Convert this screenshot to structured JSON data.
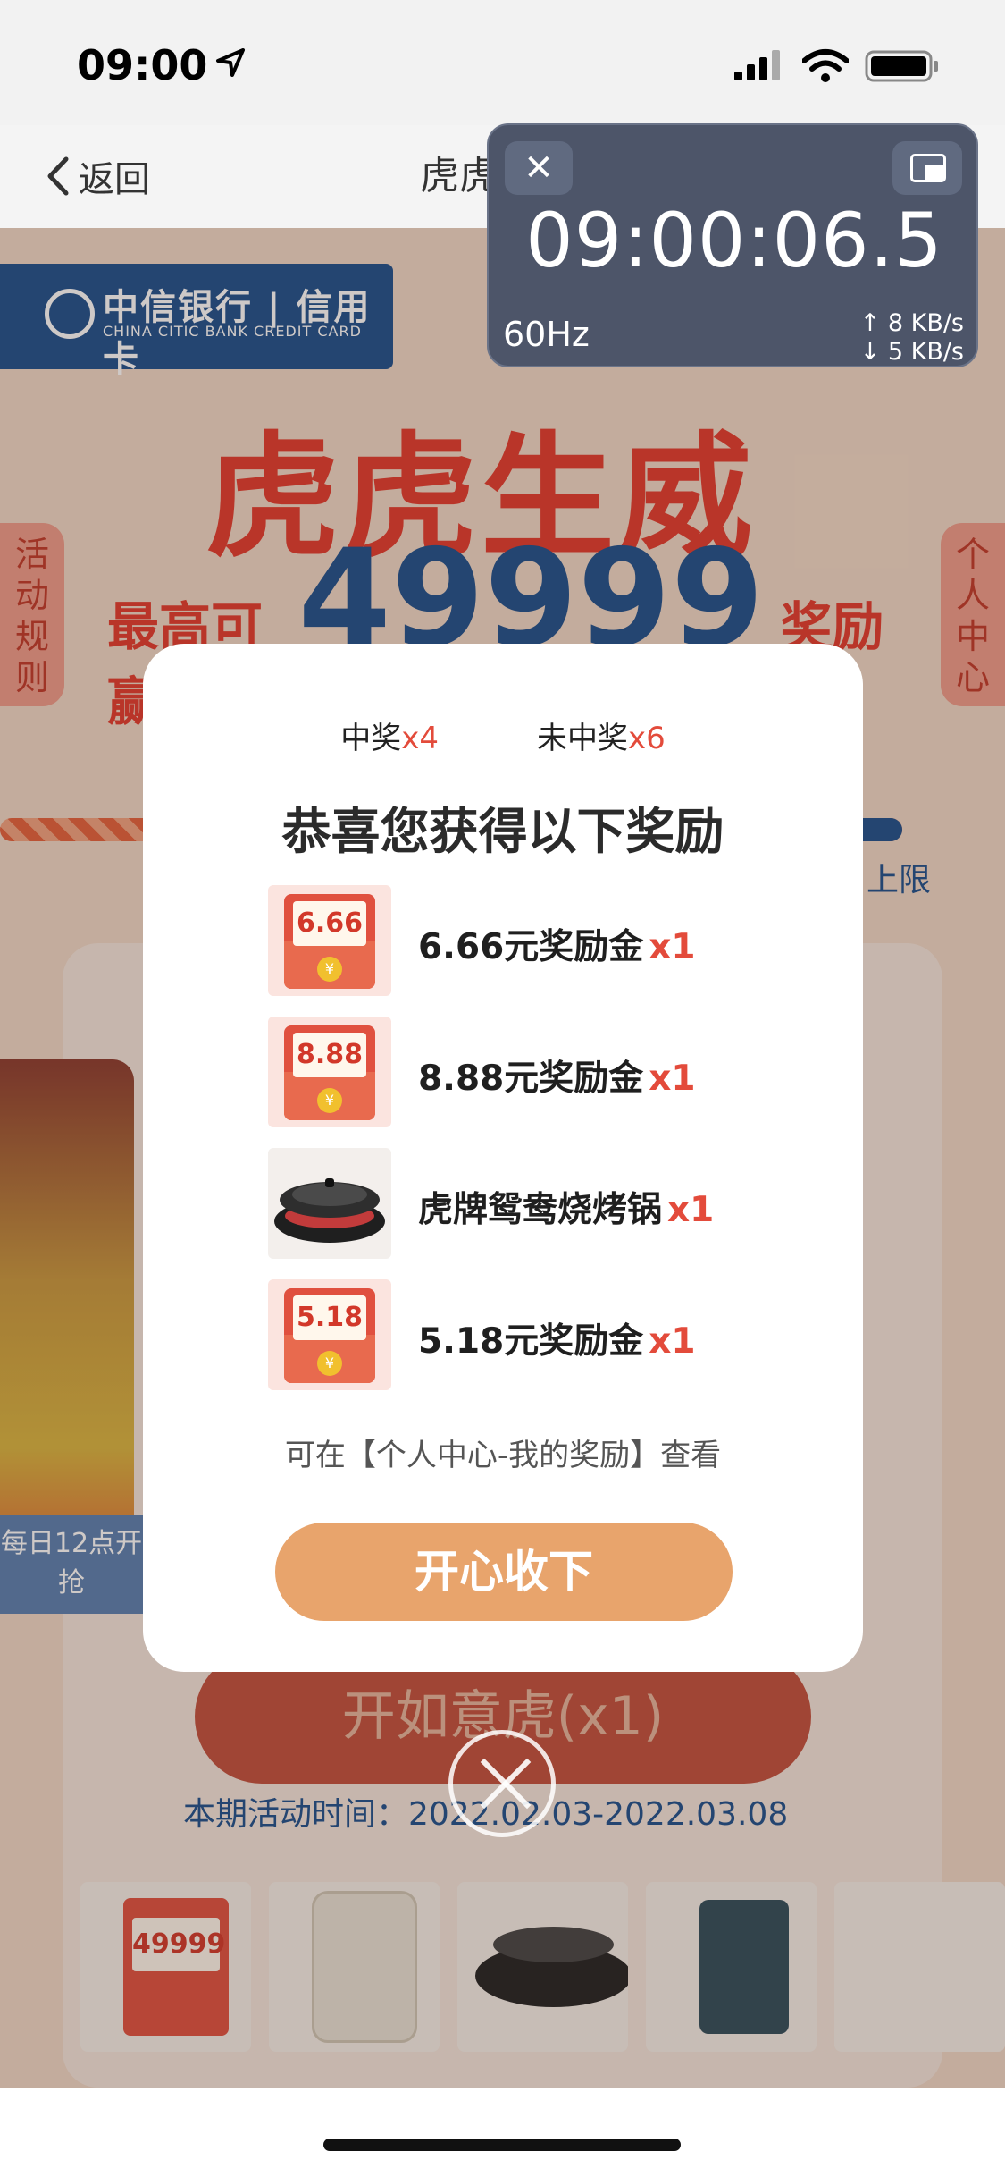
{
  "status_bar": {
    "time": "09:00"
  },
  "nav": {
    "back_label": "返回",
    "title_partial": "虎虎"
  },
  "timer_widget": {
    "clock": "09:00:06.5",
    "refresh_rate": "60Hz",
    "upload": "↑ 8 KB/s",
    "download": "↓ 5 KB/s"
  },
  "background_page": {
    "bank_name": "中信银行 | 信用卡",
    "bank_subtitle": "CHINA CITIC BANK   CREDIT CARD",
    "hero_title": "虎虎生威",
    "hero_prefix": "最高可赢",
    "hero_amount": "49999",
    "hero_suffix": "奖励金",
    "rules_tab": "活动规则",
    "personal_tab": "个人中心",
    "limit_text": "上限",
    "daily_text": "每日12点开抢",
    "draw_button": "开如意虎(x1)",
    "period_label": "本期活动时间：2022.02.03-2022.03.08",
    "prize_thumb_label": "49999"
  },
  "modal": {
    "won_label": "中奖",
    "won_count": "x4",
    "lost_label": "未中奖",
    "lost_count": "x6",
    "heading": "恭喜您获得以下奖励",
    "rewards": [
      {
        "badge": "6.66",
        "name": "6.66元奖励金",
        "qty": "x1"
      },
      {
        "badge": "8.88",
        "name": "8.88元奖励金",
        "qty": "x1"
      },
      {
        "badge": "",
        "name": "虎牌鸳鸯烧烤锅",
        "qty": "x1"
      },
      {
        "badge": "5.18",
        "name": "5.18元奖励金",
        "qty": "x1"
      }
    ],
    "hint": "可在【个人中心-我的奖励】查看",
    "accept_button": "开心收下"
  }
}
